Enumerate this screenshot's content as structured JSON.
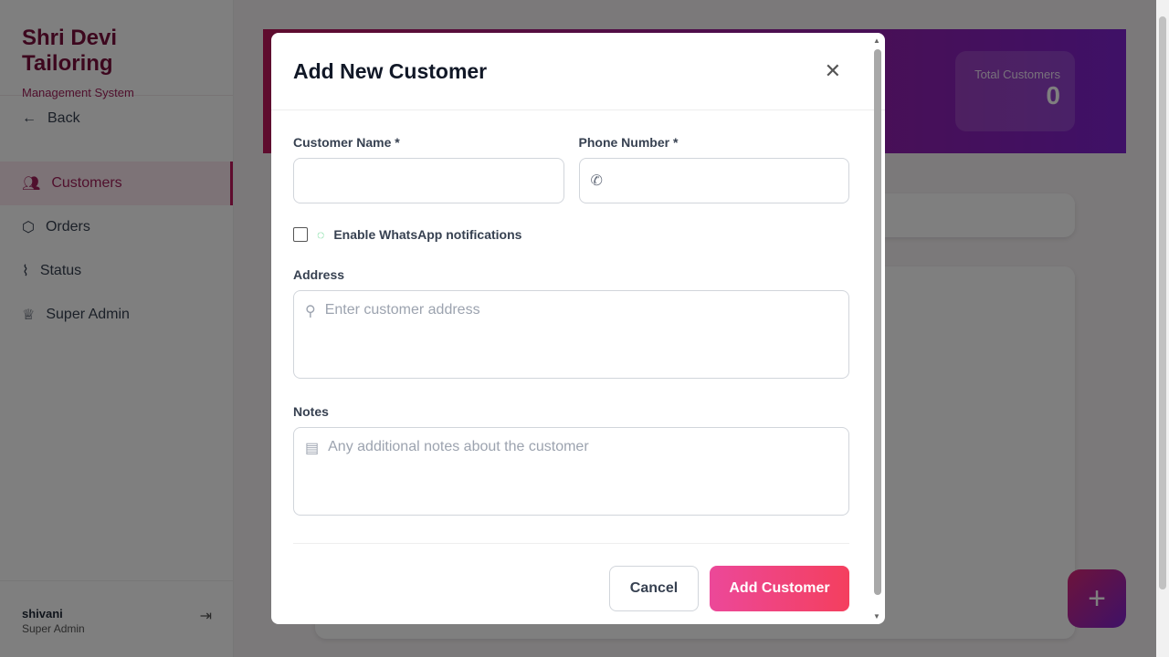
{
  "sidebar": {
    "brand": "Shri Devi Tailoring",
    "subtitle": "Management System",
    "back": "Back",
    "items": [
      {
        "label": "Customers",
        "icon": "users-icon",
        "active": true
      },
      {
        "label": "Orders",
        "icon": "package-icon"
      },
      {
        "label": "Status",
        "icon": "activity-icon"
      },
      {
        "label": "Super Admin",
        "icon": "crown-icon"
      }
    ],
    "user": {
      "name": "shivani",
      "role": "Super Admin"
    }
  },
  "hero": {
    "stat_label": "Total Customers",
    "stat_value": "0"
  },
  "modal": {
    "title": "Add New Customer",
    "name_label": "Customer Name *",
    "name_value": "",
    "phone_label": "Phone Number *",
    "phone_value": "",
    "whatsapp_label": "Enable WhatsApp notifications",
    "whatsapp_checked": false,
    "address_label": "Address",
    "address_placeholder": "Enter customer address",
    "notes_label": "Notes",
    "notes_placeholder": "Any additional notes about the customer",
    "cancel": "Cancel",
    "submit": "Add Customer"
  },
  "colors": {
    "brand": "#7a0f3d",
    "accent": "#ec4899",
    "whatsapp": "#22c55e"
  }
}
